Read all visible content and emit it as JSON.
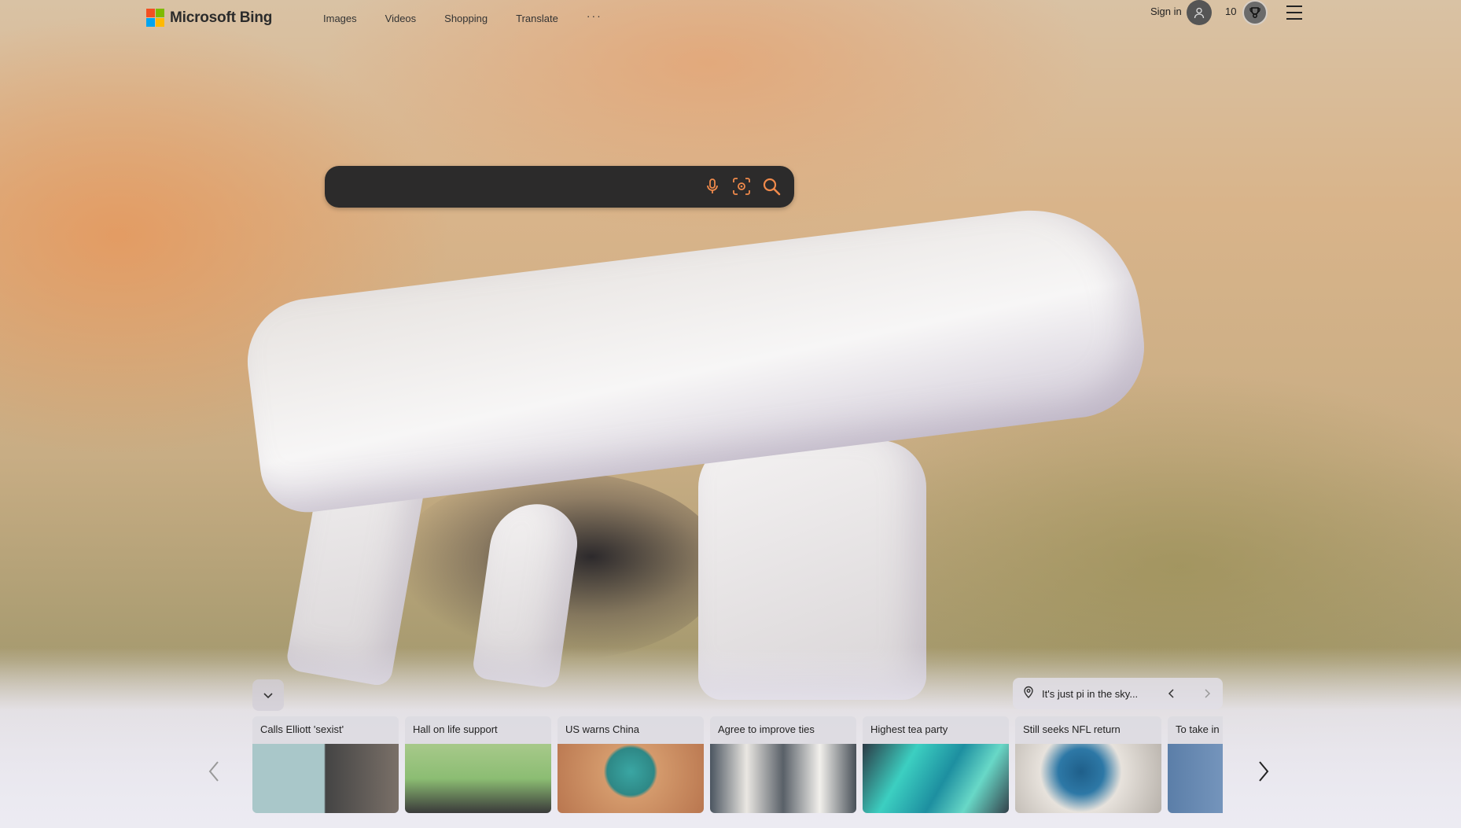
{
  "brand": {
    "name": "Microsoft Bing",
    "logo_colors": [
      "#f25022",
      "#7fba00",
      "#00a4ef",
      "#ffb900"
    ]
  },
  "nav": {
    "items": [
      {
        "label": "Images"
      },
      {
        "label": "Videos"
      },
      {
        "label": "Shopping"
      },
      {
        "label": "Translate"
      }
    ],
    "more_label": "···"
  },
  "account": {
    "signin_label": "Sign in",
    "avatar_icon": "user-icon",
    "points": "10",
    "rewards_icon": "trophy-icon",
    "menu_icon": "hamburger-menu-icon"
  },
  "search": {
    "value": "",
    "placeholder": "",
    "icons": [
      "microphone-icon",
      "visual-search-icon",
      "search-icon"
    ]
  },
  "info_bar": {
    "icon": "location-pin-icon",
    "text": "It's just pi in the sky..."
  },
  "news": {
    "collapse_icon": "chevron-down-icon",
    "cards": [
      {
        "title": "Calls Elliott 'sexist'"
      },
      {
        "title": "Hall on life support"
      },
      {
        "title": "US warns China"
      },
      {
        "title": "Agree to improve ties"
      },
      {
        "title": "Highest tea party"
      },
      {
        "title": "Still seeks NFL return"
      },
      {
        "title": "To take in r"
      }
    ]
  },
  "colors": {
    "search_bg": "#2c2b2b",
    "search_icon": "#f08a4b"
  }
}
